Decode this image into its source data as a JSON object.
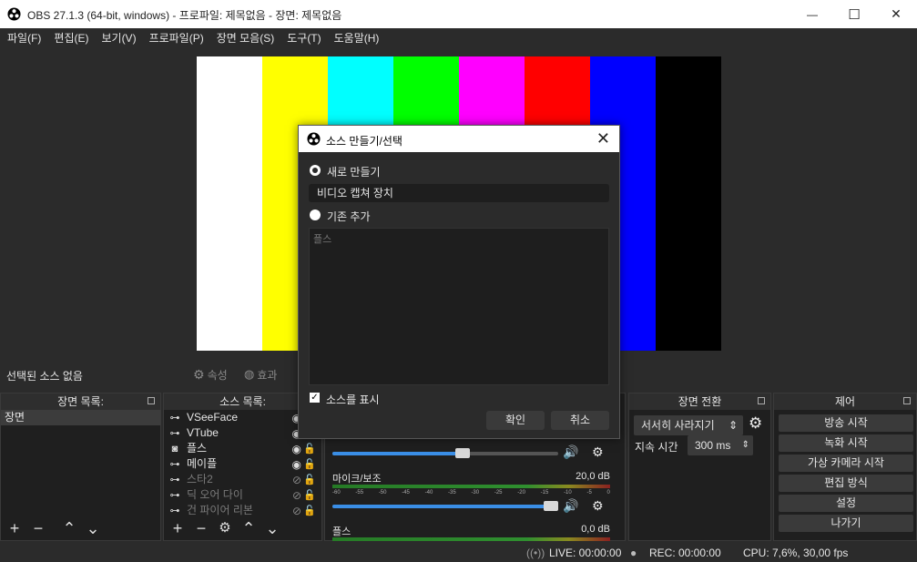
{
  "window": {
    "title": "OBS 27.1.3 (64-bit, windows) - 프로파일: 제목없음 - 장면: 제목없음",
    "minimize_glyph": "—",
    "maximize_glyph": "☐",
    "close_glyph": "✕"
  },
  "menu": [
    "파일(F)",
    "편집(E)",
    "보기(V)",
    "프로파일(P)",
    "장면 모음(S)",
    "도구(T)",
    "도움말(H)"
  ],
  "preview": {
    "color_bars": [
      "#ffffff",
      "#ffff00",
      "#00ffff",
      "#00ff00",
      "#ff00ff",
      "#ff0000",
      "#0000ff",
      "#000000"
    ]
  },
  "source_toolbar": {
    "no_source": "선택된 소스 없음",
    "properties": "속성",
    "filters": "효과"
  },
  "scenes": {
    "header": "장면 목록:",
    "items": [
      "장면"
    ]
  },
  "sources": {
    "header": "소스 목록:",
    "items": [
      {
        "name": "VSeeFace",
        "icon": "gamepad-icon",
        "glyph": "⊶",
        "dim": false
      },
      {
        "name": "VTube",
        "icon": "gamepad-icon",
        "glyph": "⊶",
        "dim": false
      },
      {
        "name": "플스",
        "icon": "camera-icon",
        "glyph": "◙",
        "dim": false
      },
      {
        "name": "메이플",
        "icon": "gamepad-icon",
        "glyph": "⊶",
        "dim": false
      },
      {
        "name": "스타2",
        "icon": "gamepad-icon",
        "glyph": "⊶",
        "dim": true
      },
      {
        "name": "딕 오어 다이",
        "icon": "gamepad-icon",
        "glyph": "⊶",
        "dim": true
      },
      {
        "name": "건 파이어 리본",
        "icon": "gamepad-icon",
        "glyph": "⊶",
        "dim": true
      }
    ]
  },
  "mixer": {
    "tracks": [
      {
        "label": "마이크/보조",
        "db": "20,0 dB",
        "volume": 1.0
      }
    ],
    "track1_volume": 0.61,
    "track3_label": "플스",
    "track3_db": "0,0 dB",
    "ticks": [
      "-60",
      "-55",
      "-50",
      "-45",
      "-40",
      "-35",
      "-30",
      "-25",
      "-20",
      "-15",
      "-10",
      "-5",
      "0"
    ]
  },
  "transitions": {
    "header": "장면 전환",
    "selected": "서서히 사라지기",
    "duration_label": "지속 시간",
    "duration_value": "300 ms"
  },
  "controls": {
    "header": "제어",
    "buttons": [
      "방송 시작",
      "녹화 시작",
      "가상 카메라 시작",
      "편집 방식",
      "설정",
      "나가기"
    ]
  },
  "status": {
    "live": "LIVE: 00:00:00",
    "rec": "REC: 00:00:00",
    "cpu": "CPU: 7,6%, 30,00 fps"
  },
  "dialog": {
    "title": "소스 만들기/선택",
    "create_new_label": "새로 만들기",
    "new_name_value": "비디오 캡쳐 장치",
    "add_existing_label": "기존 추가",
    "existing_items": [
      "플스"
    ],
    "make_visible_label": "소스를 표시",
    "ok": "확인",
    "cancel": "취소"
  }
}
